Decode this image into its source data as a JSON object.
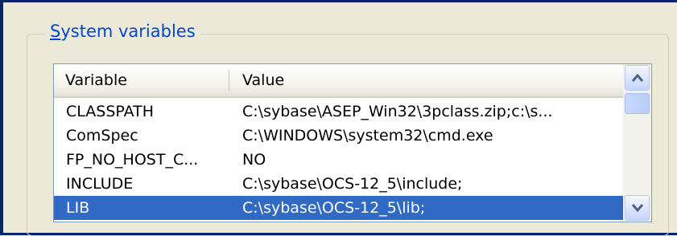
{
  "group": {
    "label": "System variables",
    "accelerator_char": "S",
    "label_rest": "ystem variables"
  },
  "columns": {
    "variable": "Variable",
    "value": "Value"
  },
  "rows": [
    {
      "variable": "CLASSPATH",
      "value": "C:\\sybase\\ASEP_Win32\\3pclass.zip;c:\\s...",
      "selected": false
    },
    {
      "variable": "ComSpec",
      "value": "C:\\WINDOWS\\system32\\cmd.exe",
      "selected": false
    },
    {
      "variable": "FP_NO_HOST_C...",
      "value": "NO",
      "selected": false
    },
    {
      "variable": "INCLUDE",
      "value": "C:\\sybase\\OCS-12_5\\include;",
      "selected": false
    },
    {
      "variable": "LIB",
      "value": "C:\\sybase\\OCS-12_5\\lib;",
      "selected": true
    }
  ],
  "icons": {
    "scroll_up": "chevron-up-icon",
    "scroll_down": "chevron-down-icon"
  },
  "colors": {
    "selection": "#316ac5",
    "group_label": "#0046d5",
    "window_bg": "#ece9d8"
  }
}
